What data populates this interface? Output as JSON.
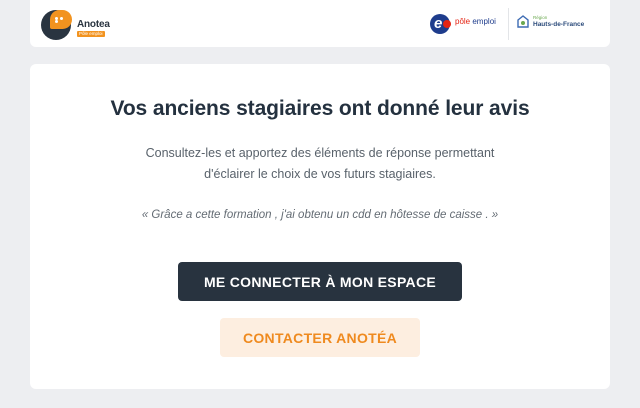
{
  "header": {
    "logo": {
      "name": "Anotea",
      "tag": "Pôle emploi",
      "icon": "speech-bubble-icon"
    },
    "partners": {
      "pole_emploi_prefix": "pôle",
      "pole_emploi_suffix": "emploi",
      "region_small": "Région",
      "region_name": "Hauts-de-France"
    }
  },
  "main": {
    "title": "Vos anciens stagiaires ont donné leur avis",
    "subtitle": "Consultez-les et apportez des éléments de réponse permettant d'éclairer le choix de vos futurs stagiaires.",
    "quote": "« Grâce a cette formation , j'ai obtenu un cdd en hôtesse de caisse . »",
    "primary_button": "ME CONNECTER À MON ESPACE",
    "secondary_button": "CONTACTER ANOTÉA"
  },
  "colors": {
    "background": "#edeef1",
    "primary_button_bg": "#28333f",
    "accent_orange": "#ef8a1f",
    "secondary_button_bg": "#fdeee0"
  }
}
